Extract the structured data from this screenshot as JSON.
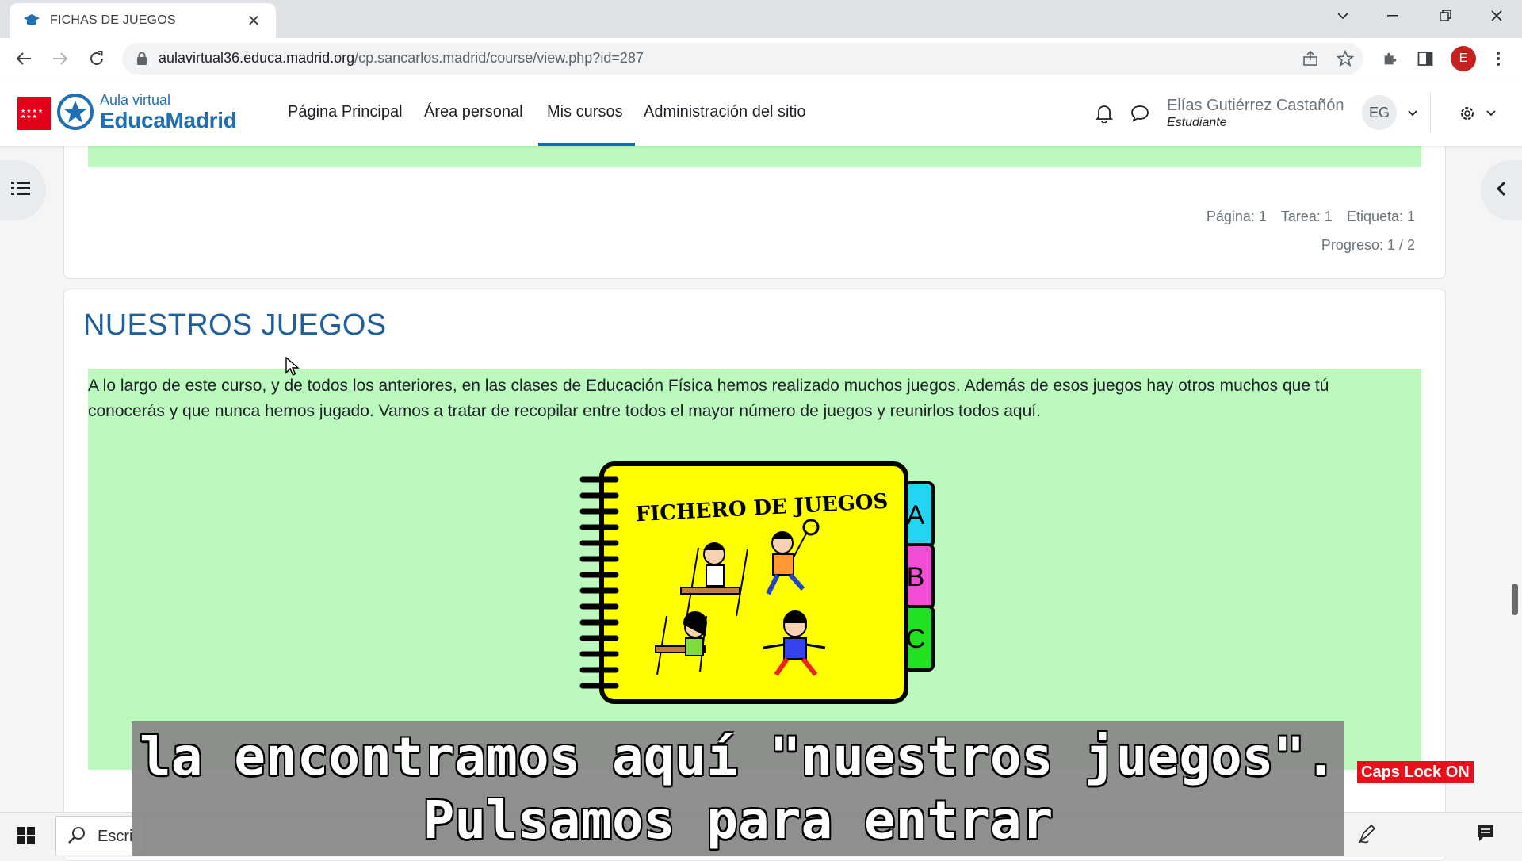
{
  "browser": {
    "tab_title": "FICHAS DE JUEGOS",
    "tab_close": "✕",
    "url_host": "aulavirtual36.educa.madrid.org",
    "url_path": "/cp.sancarlos.madrid/course/view.php?id=287",
    "profile_initial": "E"
  },
  "site": {
    "logo_top": "Aula virtual",
    "logo_main": "EducaMadrid",
    "nav": [
      "Página Principal",
      "Área personal",
      "Mis cursos",
      "Administración del sitio"
    ],
    "active_nav": "Mis cursos",
    "user_name": "Elías Gutiérrez Castañón",
    "user_role": "Estudiante",
    "avatar_initials": "EG"
  },
  "prev_section": {
    "counts": [
      "Página: 1",
      "Tarea: 1",
      "Etiqueta: 1"
    ],
    "progress": "Progreso: 1 / 2"
  },
  "section": {
    "title": "NUESTROS JUEGOS",
    "intro": "A lo largo de este curso, y de todos los anteriores, en las clases de Educación Física hemos realizado muchos juegos. Además de esos juegos hay otros muchos que tú conocerás y que nunca hemos jugado. Vamos a tratar de recopilar entre todos el mayor número de juegos y reunirlos todos aquí.",
    "image": {
      "title": "FICHERO DE JUEGOS",
      "tabs": [
        "A",
        "B",
        "C"
      ]
    }
  },
  "taskbar": {
    "search_text": "Escri"
  },
  "overlay": {
    "subtitle_lines": [
      "la encontramos aquí \"nuestros juegos\".",
      "Pulsamos para entrar"
    ],
    "caps_lock": "Caps Lock ON"
  },
  "colors": {
    "brand_blue": "#1f6fb5",
    "nav_active": "#0f6cbf",
    "section_green": "#bbf9bf",
    "notebook_yellow": "#ffff00",
    "tab_a": "#22d6f2",
    "tab_b": "#f24cd6",
    "tab_c": "#22e022"
  },
  "icons": [
    "graduation-cap-icon",
    "close-icon",
    "back-icon",
    "forward-icon",
    "reload-icon",
    "lock-icon",
    "share-icon",
    "star-icon",
    "extensions-icon",
    "sidepanel-icon",
    "menu-dots-icon",
    "bell-icon",
    "chat-icon",
    "chevron-down-icon",
    "gear-icon",
    "list-icon",
    "chevron-left-icon",
    "windows-icon",
    "search-icon",
    "pen-icon",
    "notifications-icon"
  ]
}
